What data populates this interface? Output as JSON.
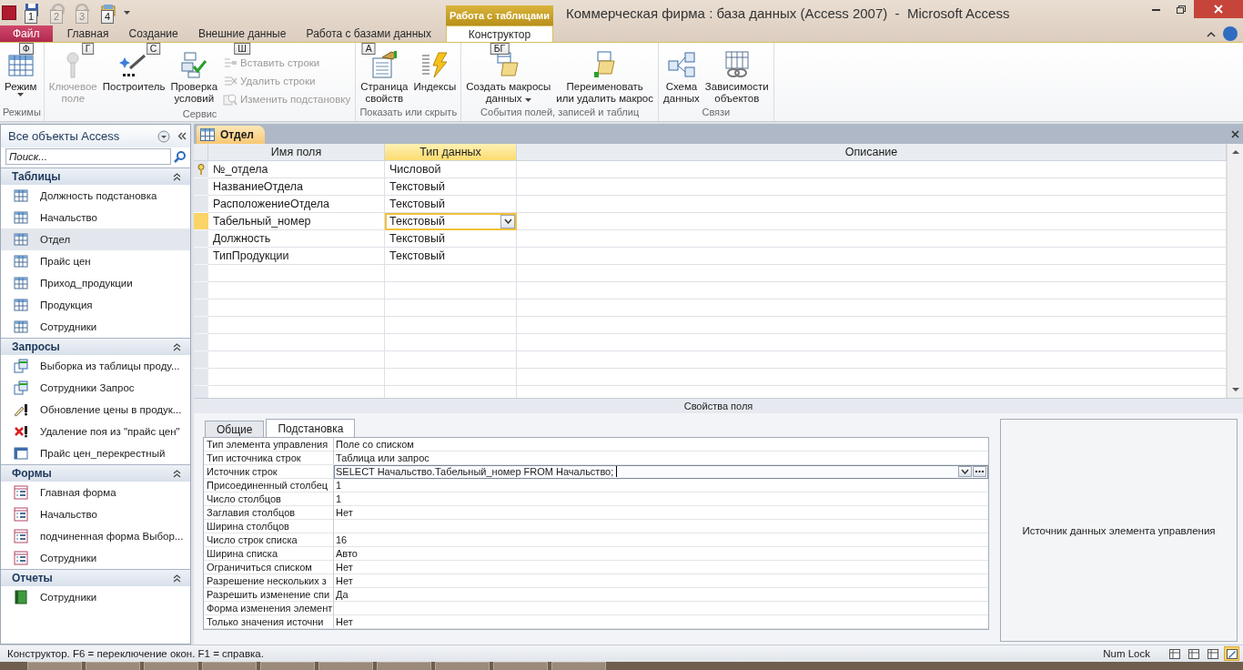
{
  "quick_access": [
    {
      "kind": "save",
      "keytip": "1",
      "disabled": false
    },
    {
      "kind": "undo",
      "keytip": "2",
      "disabled": true
    },
    {
      "kind": "redo",
      "keytip": "3",
      "disabled": true
    },
    {
      "kind": "custom",
      "keytip": "4",
      "disabled": false
    }
  ],
  "context_tab_group": "Работа с таблицами",
  "window": {
    "title": "Коммерческая фирма : база данных (Access 2007)  -  Microsoft Access"
  },
  "ribbon_tabs": [
    {
      "label": "Файл",
      "kind": "file",
      "keytip": "Ф",
      "selected": false
    },
    {
      "label": "Главная",
      "kind": "normal",
      "keytip": "Г",
      "selected": false
    },
    {
      "label": "Создание",
      "kind": "normal",
      "keytip": "С",
      "selected": false
    },
    {
      "label": "Внешние данные",
      "kind": "normal",
      "keytip": "Ш",
      "selected": false
    },
    {
      "label": "Работа с базами данных",
      "kind": "normal",
      "keytip": "А",
      "selected": false
    },
    {
      "label": "Конструктор",
      "kind": "contextual",
      "keytip": "БГ",
      "selected": true
    }
  ],
  "ribbon_groups": [
    {
      "title": "Режимы",
      "controls": [
        {
          "kind": "large",
          "lines": [
            "Режим"
          ],
          "dropdown": true,
          "disabled": false
        }
      ]
    },
    {
      "title": "Сервис",
      "controls": [
        {
          "kind": "large",
          "lines": [
            "Ключевое",
            "поле"
          ],
          "dropdown": false,
          "disabled": true
        },
        {
          "kind": "large",
          "lines": [
            "Построитель"
          ],
          "dropdown": false,
          "disabled": false
        },
        {
          "kind": "large",
          "lines": [
            "Проверка",
            "условий"
          ],
          "dropdown": false,
          "disabled": false
        },
        {
          "kind": "small",
          "lines": [
            "Вставить строки"
          ],
          "dropdown": false,
          "disabled": true
        },
        {
          "kind": "small",
          "lines": [
            "Удалить строки"
          ],
          "dropdown": false,
          "disabled": true
        },
        {
          "kind": "small",
          "lines": [
            "Изменить подстановку"
          ],
          "dropdown": false,
          "disabled": true
        }
      ]
    },
    {
      "title": "Показать или скрыть",
      "controls": [
        {
          "kind": "large",
          "lines": [
            "Страница",
            "свойств"
          ],
          "dropdown": false,
          "disabled": false
        },
        {
          "kind": "large",
          "lines": [
            "Индексы"
          ],
          "dropdown": false,
          "disabled": false
        }
      ]
    },
    {
      "title": "События полей, записей и таблиц",
      "controls": [
        {
          "kind": "large",
          "lines": [
            "Создать макросы",
            "данных"
          ],
          "dropdown": true,
          "disabled": false
        },
        {
          "kind": "large",
          "lines": [
            "Переименовать",
            "или удалить макрос"
          ],
          "dropdown": false,
          "disabled": false
        }
      ]
    },
    {
      "title": "Связи",
      "controls": [
        {
          "kind": "large",
          "lines": [
            "Схема",
            "данных"
          ],
          "dropdown": false,
          "disabled": false
        },
        {
          "kind": "large",
          "lines": [
            "Зависимости",
            "объектов"
          ],
          "dropdown": false,
          "disabled": false
        }
      ]
    }
  ],
  "nav": {
    "title": "Все объекты Access",
    "search_placeholder": "Поиск...",
    "groups": [
      {
        "title": "Таблицы",
        "expanded": true,
        "items": [
          {
            "label": "Должность подстановка",
            "kind": "table",
            "selected": false
          },
          {
            "label": "Начальство",
            "kind": "table",
            "selected": false
          },
          {
            "label": "Отдел",
            "kind": "table",
            "selected": true
          },
          {
            "label": "Прайс цен",
            "kind": "table",
            "selected": false
          },
          {
            "label": "Приход_продукции",
            "kind": "table",
            "selected": false
          },
          {
            "label": "Продукция",
            "kind": "table",
            "selected": false
          },
          {
            "label": "Сотрудники",
            "kind": "table",
            "selected": false
          }
        ]
      },
      {
        "title": "Запросы",
        "expanded": true,
        "items": [
          {
            "label": "Выборка из таблицы проду...",
            "kind": "select-query",
            "selected": false
          },
          {
            "label": "Сотрудники Запрос",
            "kind": "select-query",
            "selected": false
          },
          {
            "label": "Обновление цены в продук...",
            "kind": "update-query",
            "selected": false
          },
          {
            "label": "Удаление поя из \"прайс цен\"",
            "kind": "delete-query",
            "selected": false
          },
          {
            "label": "Прайс цен_перекрестный",
            "kind": "crosstab-query",
            "selected": false
          }
        ]
      },
      {
        "title": "Формы",
        "expanded": true,
        "items": [
          {
            "label": "Главная форма",
            "kind": "form",
            "selected": false
          },
          {
            "label": "Начальство",
            "kind": "form",
            "selected": false
          },
          {
            "label": "подчиненная форма Выбор...",
            "kind": "form",
            "selected": false
          },
          {
            "label": "Сотрудники",
            "kind": "form",
            "selected": false
          }
        ]
      },
      {
        "title": "Отчеты",
        "expanded": true,
        "items": [
          {
            "label": "Сотрудники",
            "kind": "report",
            "selected": false
          }
        ]
      }
    ]
  },
  "document": {
    "tab": "Отдел",
    "columns": [
      {
        "label": "Имя поля",
        "selected": false
      },
      {
        "label": "Тип данных",
        "selected": true
      },
      {
        "label": "Описание",
        "selected": false
      }
    ],
    "rows": [
      {
        "name": "№_отдела",
        "type": "Числовой",
        "primary_key": true,
        "selected": false
      },
      {
        "name": "НазваниеОтдела",
        "type": "Текстовый",
        "primary_key": false,
        "selected": false
      },
      {
        "name": "РасположениеОтдела",
        "type": "Текстовый",
        "primary_key": false,
        "selected": false
      },
      {
        "name": "Табельный_номер",
        "type": "Текстовый",
        "primary_key": false,
        "selected": true
      },
      {
        "name": "Должность",
        "type": "Текстовый",
        "primary_key": false,
        "selected": false
      },
      {
        "name": "ТипПродукции",
        "type": "Текстовый",
        "primary_key": false,
        "selected": false
      }
    ],
    "section_label": "Свойства поля",
    "property_tabs": [
      {
        "label": "Общие",
        "selected": false
      },
      {
        "label": "Подстановка",
        "selected": true
      }
    ],
    "properties": [
      {
        "label": "Тип элемента управления",
        "value": "Поле со списком",
        "selected": false
      },
      {
        "label": "Тип источника строк",
        "value": "Таблица или запрос",
        "selected": false
      },
      {
        "label": "Источник строк",
        "value": "SELECT Начальство.Табельный_номер FROM Начальство;",
        "selected": true
      },
      {
        "label": "Присоединенный столбец",
        "value": "1",
        "selected": false
      },
      {
        "label": "Число столбцов",
        "value": "1",
        "selected": false
      },
      {
        "label": "Заглавия столбцов",
        "value": "Нет",
        "selected": false
      },
      {
        "label": "Ширина столбцов",
        "selected": false
      },
      {
        "label": "Число строк списка",
        "value": "16",
        "selected": false
      },
      {
        "label": "Ширина списка",
        "value": "Авто",
        "selected": false
      },
      {
        "label": "Ограничиться списком",
        "value": "Нет",
        "selected": false
      },
      {
        "label": "Разрешение нескольких з",
        "value": "Нет",
        "selected": false
      },
      {
        "label": "Разрешить изменение спи",
        "value": "Да",
        "selected": false
      },
      {
        "label": "Форма изменения элемент",
        "selected": false
      },
      {
        "label": "Только значения источни",
        "value": "Нет",
        "selected": false
      }
    ],
    "help_text": "Источник данных элемента управления"
  },
  "status_bar": {
    "text": "Конструктор.  F6 = переключение окон.  F1 = справка.",
    "indicator": "Num Lock",
    "views": [
      {
        "kind": "datasheet",
        "selected": false
      },
      {
        "kind": "pivot-table",
        "selected": false
      },
      {
        "kind": "pivot-chart",
        "selected": false
      },
      {
        "kind": "design",
        "selected": true
      }
    ]
  }
}
